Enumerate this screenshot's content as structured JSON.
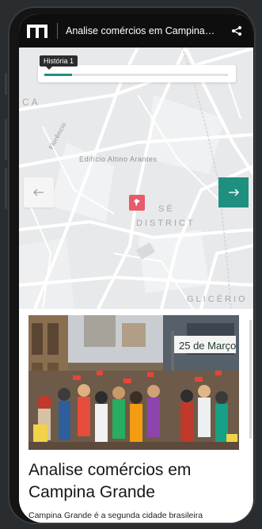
{
  "header": {
    "title": "Analise comércios em Campina Grande",
    "logo_icon": "storymap-logo-icon",
    "share_icon": "share-icon"
  },
  "map": {
    "progress": {
      "label": "História 1",
      "fraction": 0.15
    },
    "labels": {
      "building": "Edifício Altino Arantes",
      "district_line1": "SÉ",
      "district_line2": "DISTRICT",
      "neighborhood": "GLICÉRIO",
      "street": "Florêncio",
      "corner": "CA"
    },
    "nav": {
      "prev_icon": "arrow-left-icon",
      "next_icon": "arrow-right-icon"
    },
    "marker_icon": "pin-marker-icon",
    "colors": {
      "accent": "#1f8f80",
      "marker": "#e85b6a"
    }
  },
  "story": {
    "photo_sign": "25 de Março",
    "title": "Analise comércios em Campina Grande",
    "text": "Campina Grande é a segunda cidade brasileira"
  }
}
